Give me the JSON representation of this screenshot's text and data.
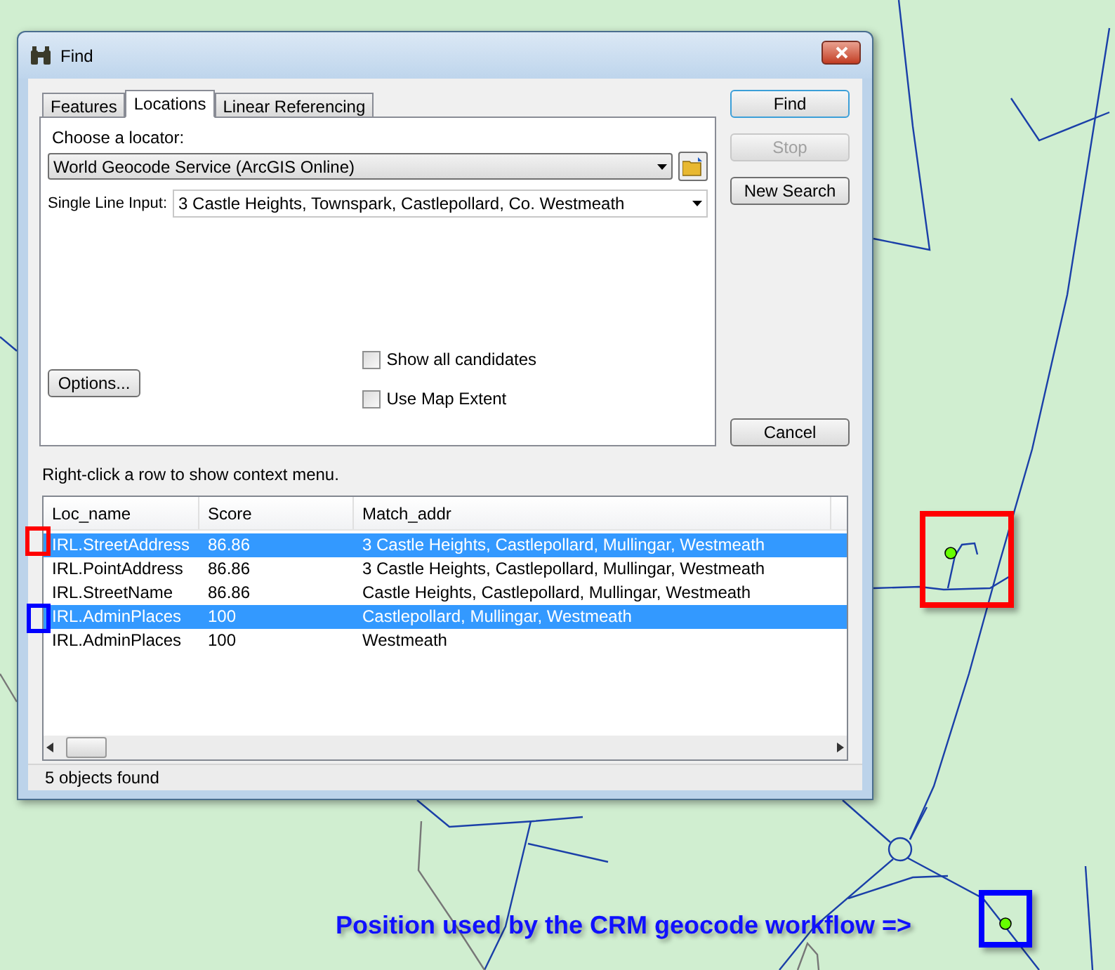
{
  "window": {
    "title": "Find"
  },
  "tabs": [
    {
      "label": "Features",
      "selected": false
    },
    {
      "label": "Locations",
      "selected": true
    },
    {
      "label": "Linear Referencing",
      "selected": false
    }
  ],
  "locator": {
    "label": "Choose a locator:",
    "value": "World Geocode Service (ArcGIS Online)"
  },
  "single_line_input": {
    "label": "Single Line Input:",
    "value": "3 Castle Heights, Townspark, Castlepollard, Co. Westmeath"
  },
  "checkboxes": [
    {
      "label": "Show all candidates",
      "checked": false
    },
    {
      "label": "Use Map Extent",
      "checked": false
    }
  ],
  "options_button": "Options...",
  "buttons": [
    {
      "label": "Find",
      "disabled": false,
      "default": true
    },
    {
      "label": "Stop",
      "disabled": true,
      "default": false
    },
    {
      "label": "New Search",
      "disabled": false,
      "default": false
    }
  ],
  "cancel_button": "Cancel",
  "hint": "Right-click a row to show context menu.",
  "table": {
    "columns": [
      "Loc_name",
      "Score",
      "Match_addr"
    ],
    "rows": [
      {
        "cells": [
          "IRL.StreetAddress",
          "86.86",
          "3 Castle Heights, Castlepollard, Mullingar, Westmeath"
        ],
        "selected": true
      },
      {
        "cells": [
          "IRL.PointAddress",
          "86.86",
          "3 Castle Heights, Castlepollard, Mullingar, Westmeath"
        ],
        "selected": false
      },
      {
        "cells": [
          "IRL.StreetName",
          "86.86",
          "Castle Heights, Castlepollard, Mullingar, Westmeath"
        ],
        "selected": false
      },
      {
        "cells": [
          "IRL.AdminPlaces",
          "100",
          "Castlepollard, Mullingar, Westmeath"
        ],
        "selected": true
      },
      {
        "cells": [
          "IRL.AdminPlaces",
          "100",
          "Westmeath"
        ],
        "selected": false
      }
    ]
  },
  "status_bar": "5 objects found",
  "row_markers": [
    {
      "color": "#ff0000"
    },
    {
      "color": "#0000ff"
    }
  ],
  "map_markers": [
    {
      "color": "#ff0000"
    },
    {
      "color": "#0000ff"
    }
  ],
  "caption": "Position used by the CRM geocode workflow =>"
}
